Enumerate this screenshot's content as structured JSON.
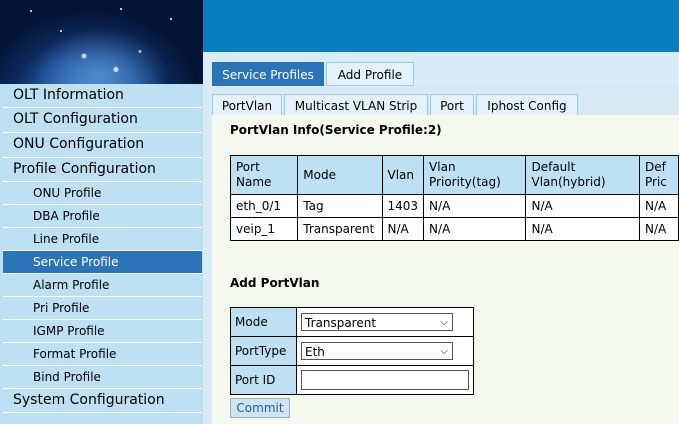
{
  "sidebar": {
    "items": [
      {
        "label": "OLT Information"
      },
      {
        "label": "OLT Configuration"
      },
      {
        "label": "ONU Configuration"
      },
      {
        "label": "Profile Configuration"
      },
      {
        "label": "ONU Profile"
      },
      {
        "label": "DBA Profile"
      },
      {
        "label": "Line Profile"
      },
      {
        "label": "Service Profile"
      },
      {
        "label": "Alarm Profile"
      },
      {
        "label": "Pri Profile"
      },
      {
        "label": "IGMP Profile"
      },
      {
        "label": "Format Profile"
      },
      {
        "label": "Bind Profile"
      },
      {
        "label": "System Configuration"
      }
    ]
  },
  "tabs_top": [
    {
      "label": "Service Profiles"
    },
    {
      "label": "Add Profile"
    }
  ],
  "tabs_sub": [
    {
      "label": "PortVlan"
    },
    {
      "label": "Multicast VLAN Strip"
    },
    {
      "label": "Port"
    },
    {
      "label": "Iphost Config"
    }
  ],
  "portvlan_info": {
    "title": "PortVlan Info(Service Profile:2)",
    "headers": [
      "Port Name",
      "Mode",
      "Vlan",
      "Vlan Priority(tag)",
      "Default Vlan(hybrid)",
      "Def Prio"
    ],
    "header_lines": [
      [
        "Port",
        "Name"
      ],
      [
        "Mode",
        ""
      ],
      [
        "Vlan",
        ""
      ],
      [
        "Vlan",
        "Priority(tag)"
      ],
      [
        "Default",
        "Vlan(hybrid)"
      ],
      [
        "Def",
        "Pric"
      ]
    ],
    "rows": [
      [
        "eth_0/1",
        "Tag",
        "1403",
        "N/A",
        "N/A",
        "N/A"
      ],
      [
        "veip_1",
        "Transparent",
        "N/A",
        "N/A",
        "N/A",
        "N/A"
      ]
    ]
  },
  "add_portvlan": {
    "title": "Add PortVlan",
    "mode_label": "Mode",
    "mode_value": "Transparent",
    "porttype_label": "PortType",
    "porttype_value": "Eth",
    "portid_label": "Port ID",
    "portid_value": "",
    "commit_label": "Commit"
  },
  "colors": {
    "accent": "#2b74b7",
    "banner": "#0a7fbf",
    "sidebar_bg": "#bde1f2"
  }
}
